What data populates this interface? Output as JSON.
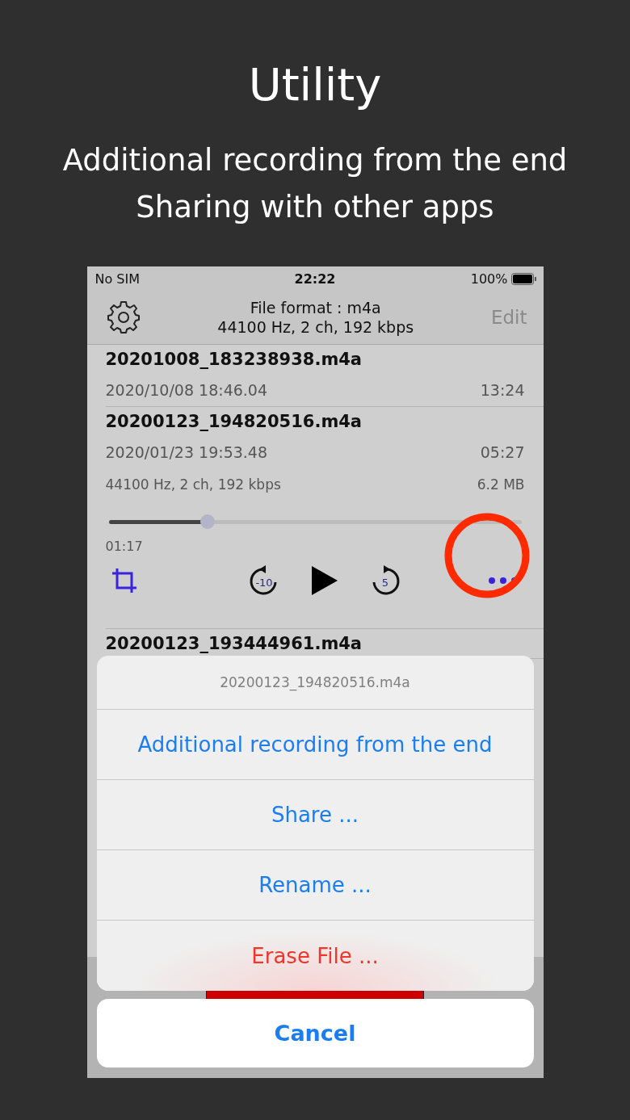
{
  "headline": "Utility",
  "subtitle_lines": [
    "Additional recording from the end",
    "Sharing with other apps"
  ],
  "status_bar": {
    "carrier": "No SIM",
    "time": "22:22",
    "battery": "100%"
  },
  "nav": {
    "title": "File format : m4a",
    "subtitle": "44100 Hz, 2 ch, 192 kbps",
    "edit": "Edit"
  },
  "recordings": [
    {
      "name": "20201008_183238938.m4a",
      "date": "2020/10/08 18:46.04",
      "duration": "13:24"
    },
    {
      "name": "20200123_194820516.m4a",
      "date": "2020/01/23 19:53.48",
      "duration": "05:27",
      "format": "44100 Hz, 2 ch, 192 kbps",
      "size": "6.2 MB",
      "position": "01:17",
      "level": 0.24,
      "skip_back": "-10",
      "skip_forward": "5"
    },
    {
      "name": "20200123_193444961.m4a"
    }
  ],
  "action_sheet": {
    "title": "20200123_194820516.m4a",
    "actions": [
      {
        "label": "Additional recording from the end",
        "kind": "default"
      },
      {
        "label": "Share ...",
        "kind": "default"
      },
      {
        "label": "Rename ...",
        "kind": "default"
      },
      {
        "label": "Erase File ...",
        "kind": "destructive"
      }
    ],
    "cancel": "Cancel"
  }
}
